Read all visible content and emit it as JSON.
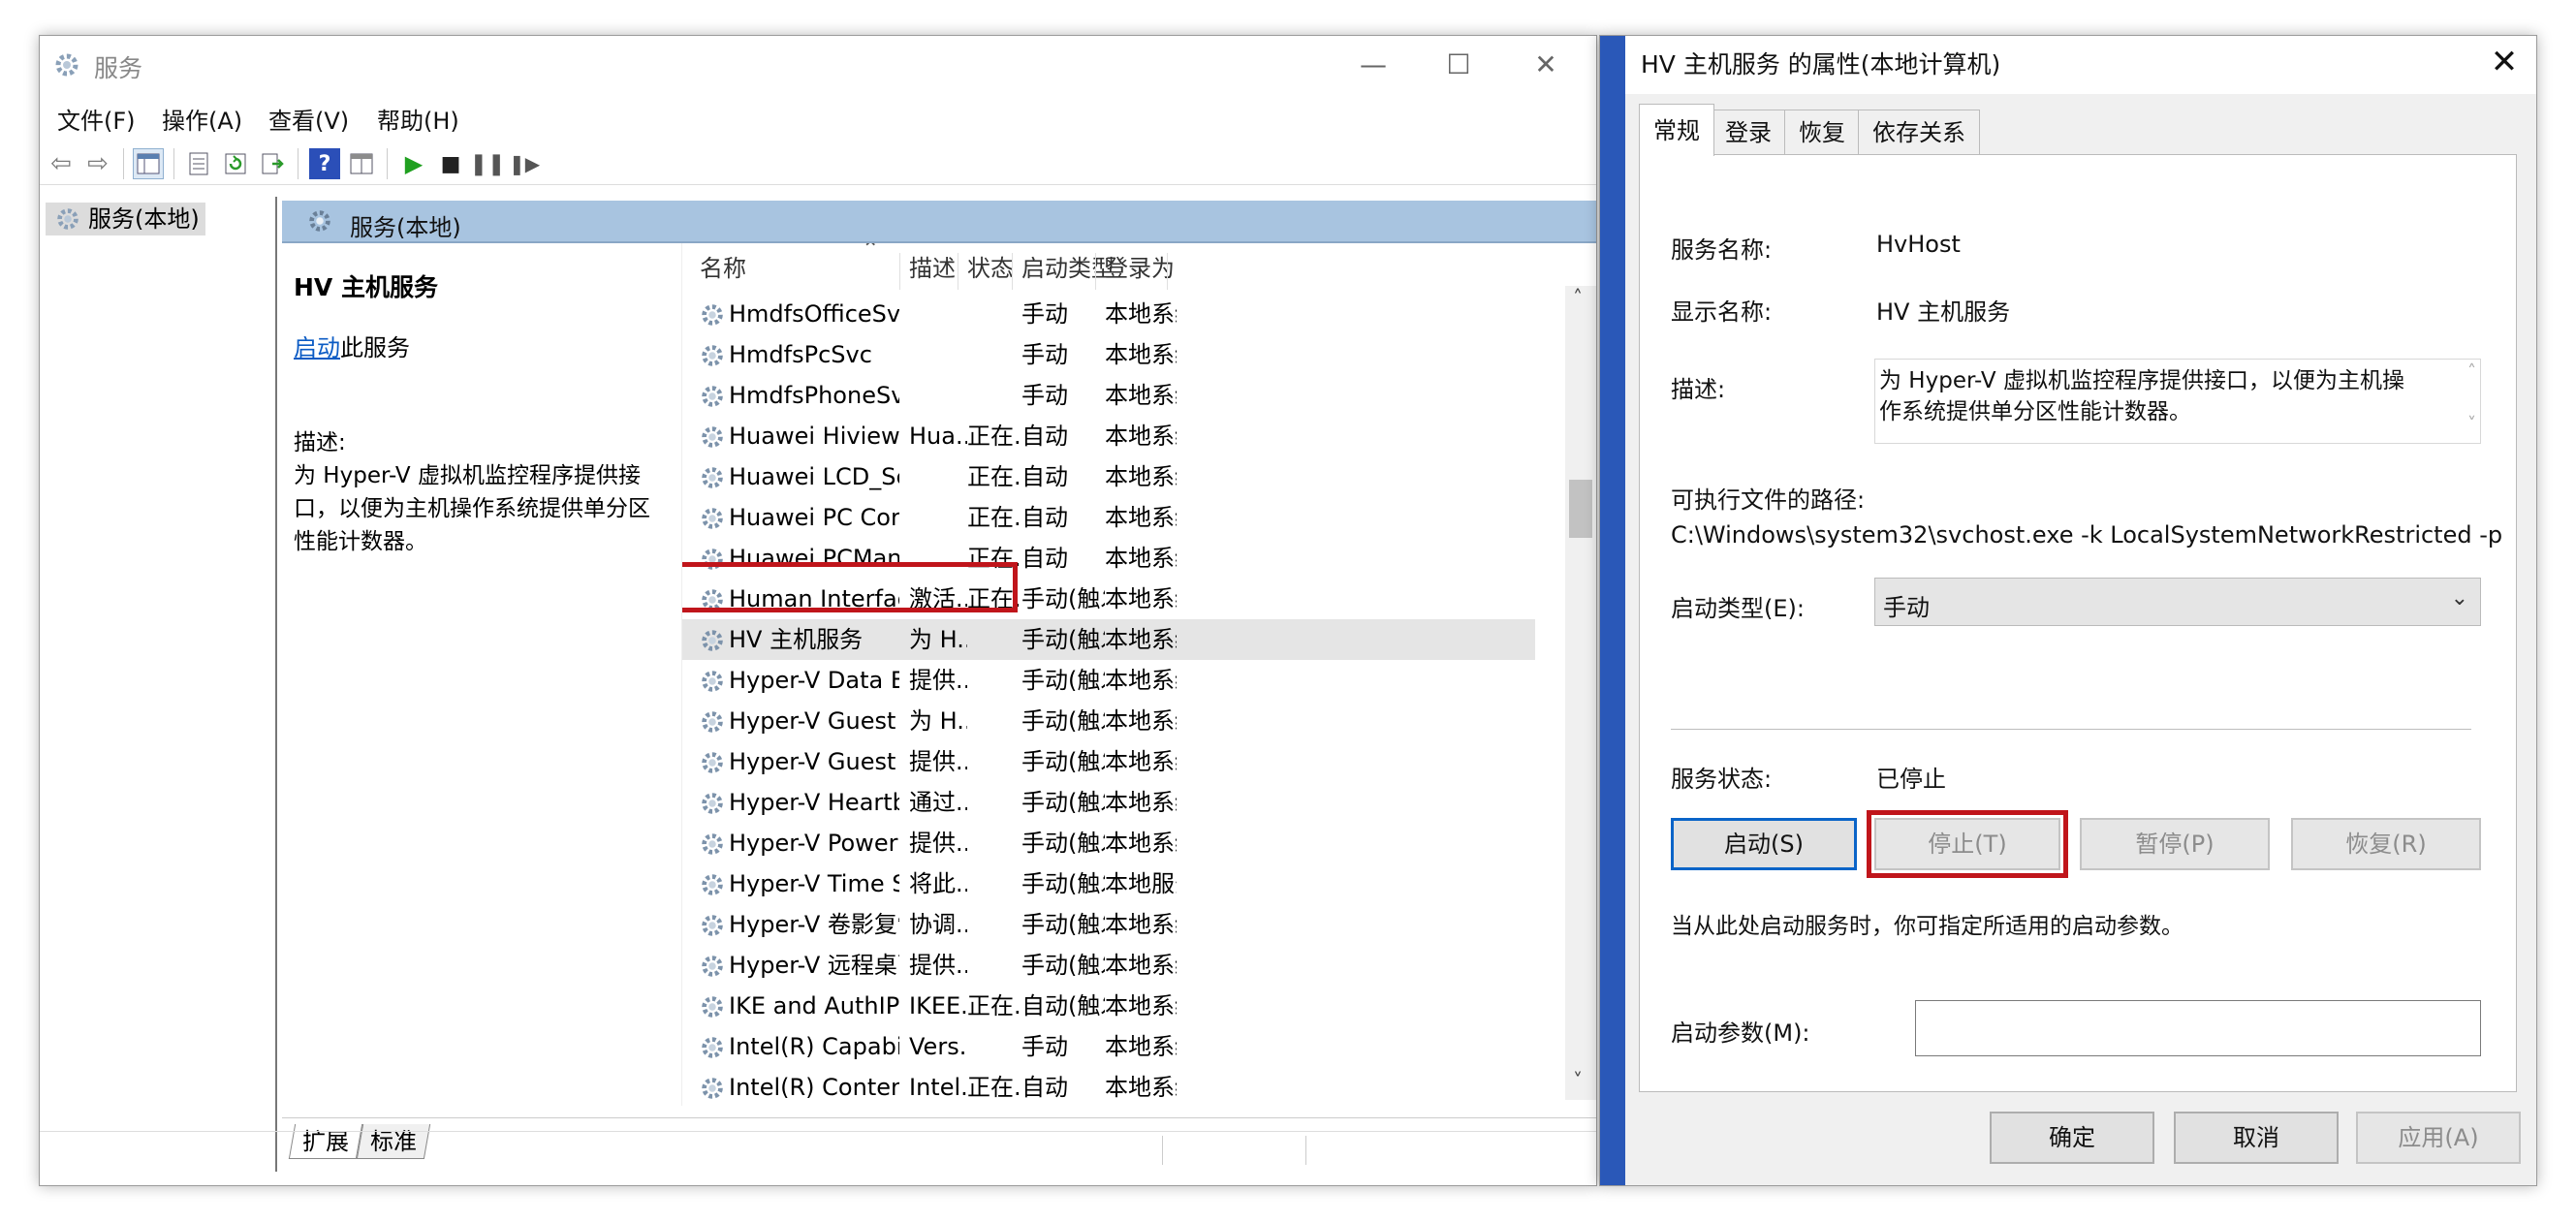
{
  "services_window": {
    "title": "服务",
    "menus": [
      "文件(F)",
      "操作(A)",
      "查看(V)",
      "帮助(H)"
    ],
    "tree_item": "服务(本地)",
    "pane_header": "服务(本地)",
    "detail": {
      "service_name": "HV 主机服务",
      "start_link": "启动",
      "start_suffix": "此服务",
      "desc_label": "描述:",
      "desc_line1": "为 Hyper-V 虚拟机监控程序提供接",
      "desc_line2": "口，以便为主机操作系统提供单分区",
      "desc_line3": "性能计数器。"
    },
    "columns": [
      "名称",
      "描述",
      "状态",
      "启动类型",
      "登录为"
    ],
    "rows": [
      {
        "name": "HmdfsOfficeSvc",
        "desc": "",
        "status": "",
        "startup": "手动",
        "logon": "本地系统"
      },
      {
        "name": "HmdfsPcSvc",
        "desc": "",
        "status": "",
        "startup": "手动",
        "logon": "本地系统"
      },
      {
        "name": "HmdfsPhoneSvc",
        "desc": "",
        "status": "",
        "startup": "手动",
        "logon": "本地系统"
      },
      {
        "name": "Huawei Hiview Windows ...",
        "desc": "Hua...",
        "status": "正在...",
        "startup": "自动",
        "logon": "本地系统"
      },
      {
        "name": "Huawei LCD_Service",
        "desc": "",
        "status": "正在...",
        "startup": "自动",
        "logon": "本地系统"
      },
      {
        "name": "Huawei PC Core Service",
        "desc": "",
        "status": "正在...",
        "startup": "自动",
        "logon": "本地系统"
      },
      {
        "name": "Huawei PCManager Win...",
        "desc": "",
        "status": "正在...",
        "startup": "自动",
        "logon": "本地系统"
      },
      {
        "name": "Human Interface Device ...",
        "desc": "激活...",
        "status": "正在...",
        "startup": "手动(触发...",
        "logon": "本地系统"
      },
      {
        "name": "HV 主机服务",
        "desc": "为 H...",
        "status": "",
        "startup": "手动(触发...",
        "logon": "本地系统"
      },
      {
        "name": "Hyper-V Data Exchange ...",
        "desc": "提供...",
        "status": "",
        "startup": "手动(触发...",
        "logon": "本地系统"
      },
      {
        "name": "Hyper-V Guest Service In...",
        "desc": "为 H...",
        "status": "",
        "startup": "手动(触发...",
        "logon": "本地系统"
      },
      {
        "name": "Hyper-V Guest Shutdown...",
        "desc": "提供...",
        "status": "",
        "startup": "手动(触发...",
        "logon": "本地系统"
      },
      {
        "name": "Hyper-V Heartbeat Service",
        "desc": "通过...",
        "status": "",
        "startup": "手动(触发...",
        "logon": "本地系统"
      },
      {
        "name": "Hyper-V PowerShell Dire...",
        "desc": "提供...",
        "status": "",
        "startup": "手动(触发...",
        "logon": "本地系统"
      },
      {
        "name": "Hyper-V Time Synchroniz...",
        "desc": "将此...",
        "status": "",
        "startup": "手动(触发...",
        "logon": "本地服务"
      },
      {
        "name": "Hyper-V 卷影复制请求程序",
        "desc": "协调...",
        "status": "",
        "startup": "手动(触发...",
        "logon": "本地系统"
      },
      {
        "name": "Hyper-V 远程桌面虚拟化...",
        "desc": "提供...",
        "status": "",
        "startup": "手动(触发...",
        "logon": "本地系统"
      },
      {
        "name": "IKE and AuthIP IPsec Key...",
        "desc": "IKEE...",
        "status": "正在...",
        "startup": "自动(触发...",
        "logon": "本地系统"
      },
      {
        "name": "Intel(R) Capability Licensi...",
        "desc": "Vers...",
        "status": "",
        "startup": "手动",
        "logon": "本地系统"
      },
      {
        "name": "Intel(R) Content Protectio...",
        "desc": "Intel...",
        "status": "正在...",
        "startup": "自动",
        "logon": "本地系统"
      }
    ],
    "bottom_tabs": [
      "扩展",
      "标准"
    ]
  },
  "dialog": {
    "title": "HV 主机服务 的属性(本地计算机)",
    "tabs": [
      "常规",
      "登录",
      "恢复",
      "依存关系"
    ],
    "service_name_label": "服务名称:",
    "service_name_value": "HvHost",
    "display_name_label": "显示名称:",
    "display_name_value": "HV 主机服务",
    "desc_label": "描述:",
    "desc_line1": "为 Hyper-V 虚拟机监控程序提供接口，以便为主机操",
    "desc_line2": "作系统提供单分区性能计数器。",
    "path_label": "可执行文件的路径:",
    "path_value": "C:\\Windows\\system32\\svchost.exe -k LocalSystemNetworkRestricted -p",
    "startup_label": "启动类型(E):",
    "startup_value": "手动",
    "status_label": "服务状态:",
    "status_value": "已停止",
    "btn_start": "启动(S)",
    "btn_stop": "停止(T)",
    "btn_pause": "暂停(P)",
    "btn_resume": "恢复(R)",
    "hint": "当从此处启动服务时，你可指定所适用的启动参数。",
    "params_label": "启动参数(M):",
    "params_value": "",
    "btn_ok": "确定",
    "btn_cancel": "取消",
    "btn_apply": "应用(A)"
  },
  "colors": {
    "highlight": "#c0151b",
    "header_blue": "#a8c4e0",
    "link": "#0b5bc4"
  }
}
